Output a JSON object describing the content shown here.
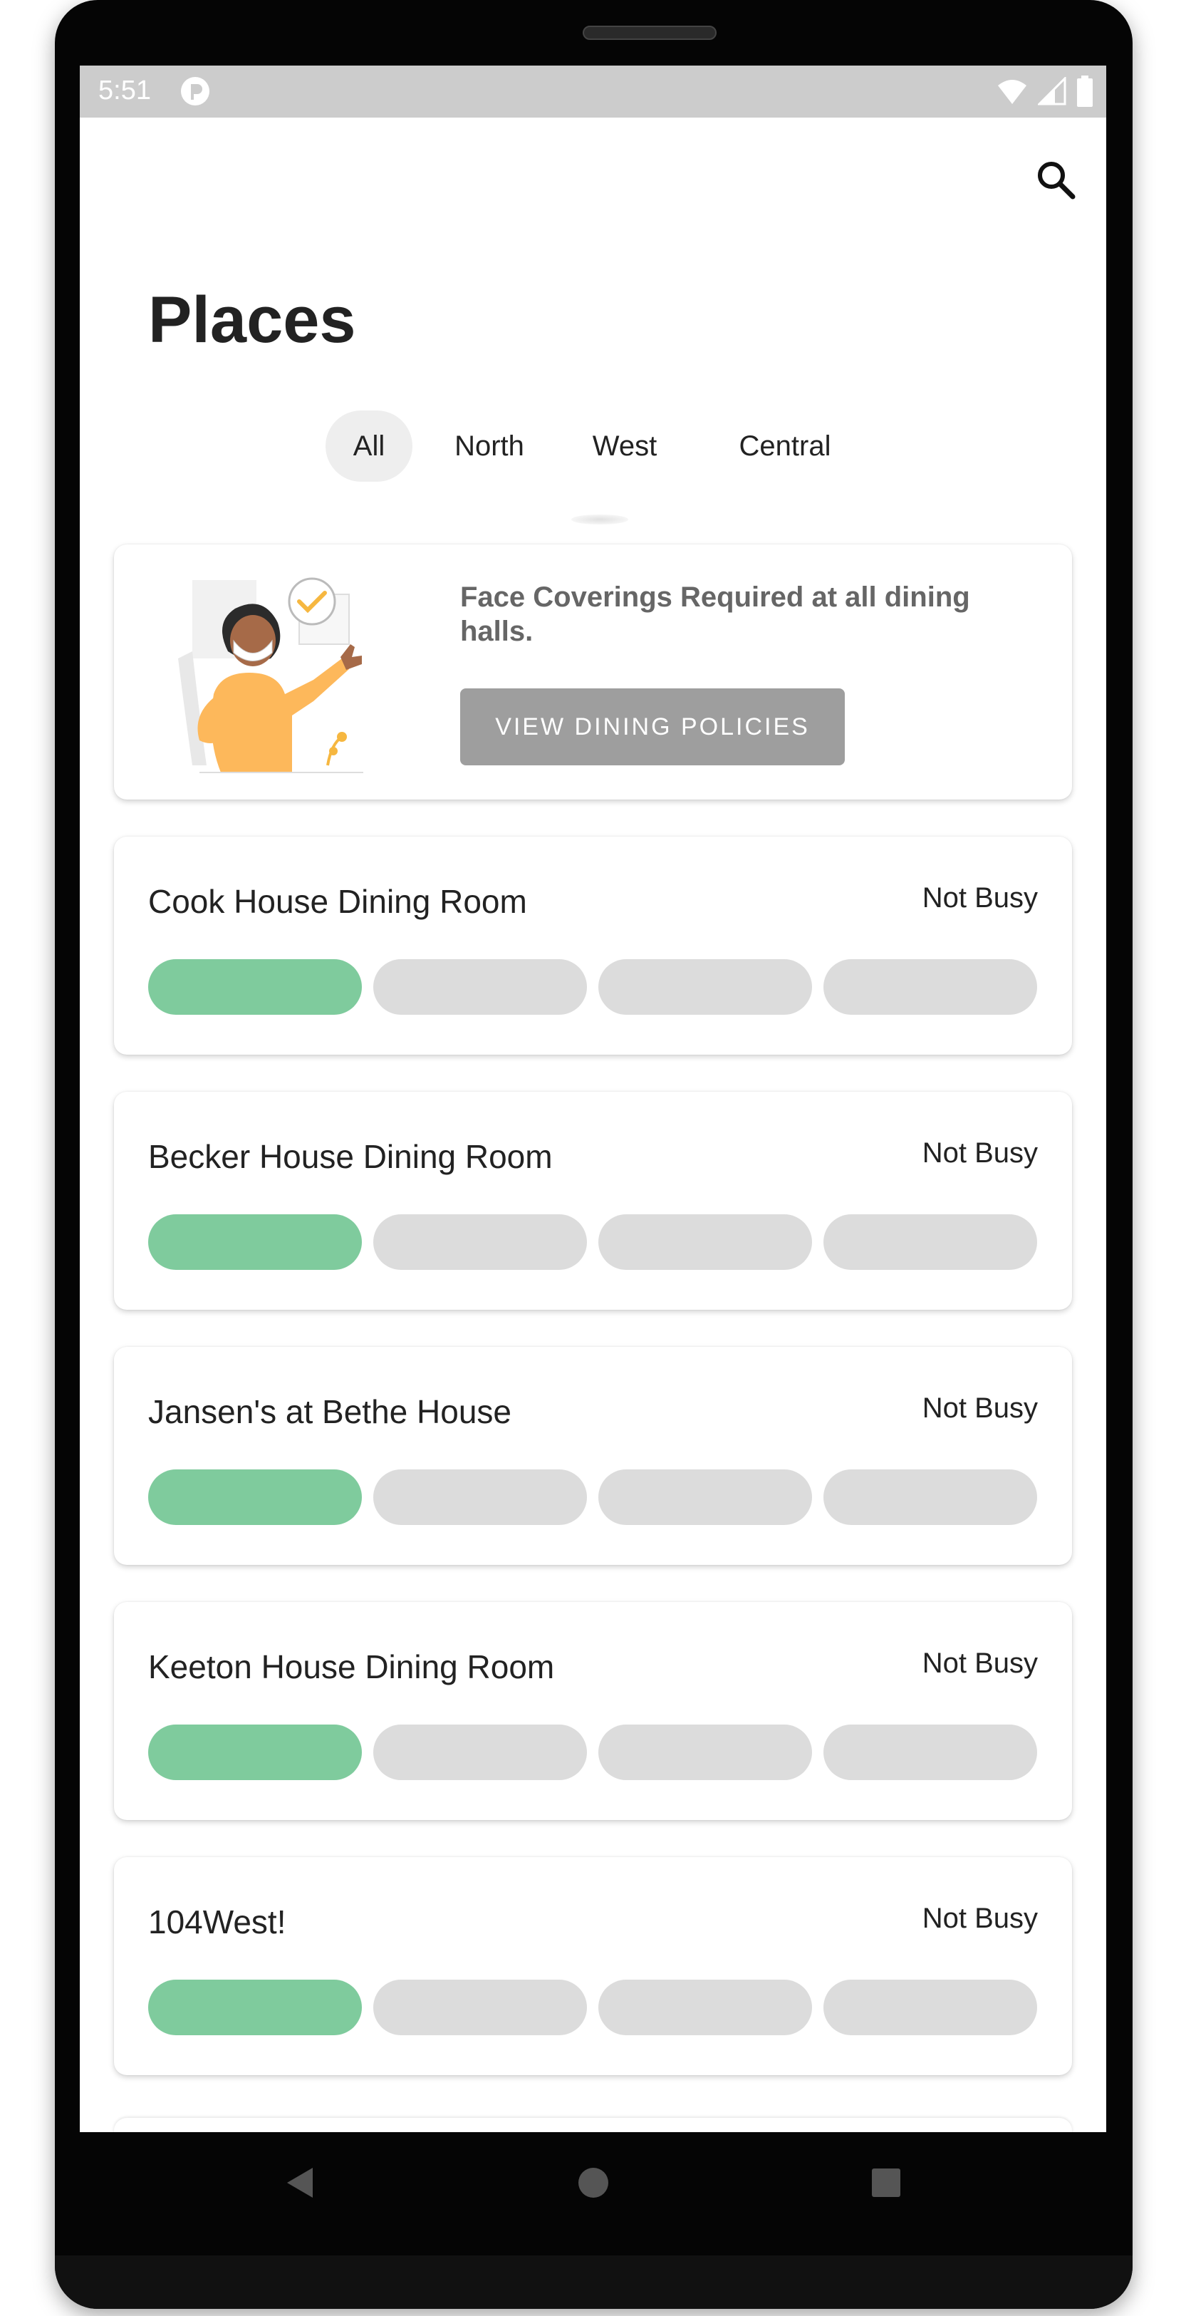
{
  "status_bar": {
    "time": "5:51"
  },
  "header": {
    "title": "Places",
    "search_icon": "search-icon"
  },
  "tabs": [
    {
      "label": "All",
      "active": true
    },
    {
      "label": "North",
      "active": false
    },
    {
      "label": "West",
      "active": false
    },
    {
      "label": "Central",
      "active": false
    }
  ],
  "policy_card": {
    "message": "Face Coverings Required at all dining halls.",
    "button_label": "VIEW DINING POLICIES",
    "illustration": "masked-person-thumbs-up-illustration"
  },
  "places": [
    {
      "name": "Cook House Dining Room",
      "status": "Not Busy",
      "level": 1
    },
    {
      "name": "Becker House Dining Room",
      "status": "Not Busy",
      "level": 1
    },
    {
      "name": "Jansen's at Bethe House",
      "status": "Not Busy",
      "level": 1
    },
    {
      "name": "Keeton House Dining Room",
      "status": "Not Busy",
      "level": 1
    },
    {
      "name": "104West!",
      "status": "Not Busy",
      "level": 1
    }
  ],
  "busyness_scale_max": 4,
  "colors": {
    "busy_active": "#7fcb9d",
    "busy_inactive": "#dcdcdc",
    "policy_button": "#9e9e9e",
    "tab_active_bg": "#eeeeee"
  },
  "nav_bar": {
    "back_icon": "back-triangle-icon",
    "home_icon": "home-circle-icon",
    "recents_icon": "recents-square-icon"
  }
}
